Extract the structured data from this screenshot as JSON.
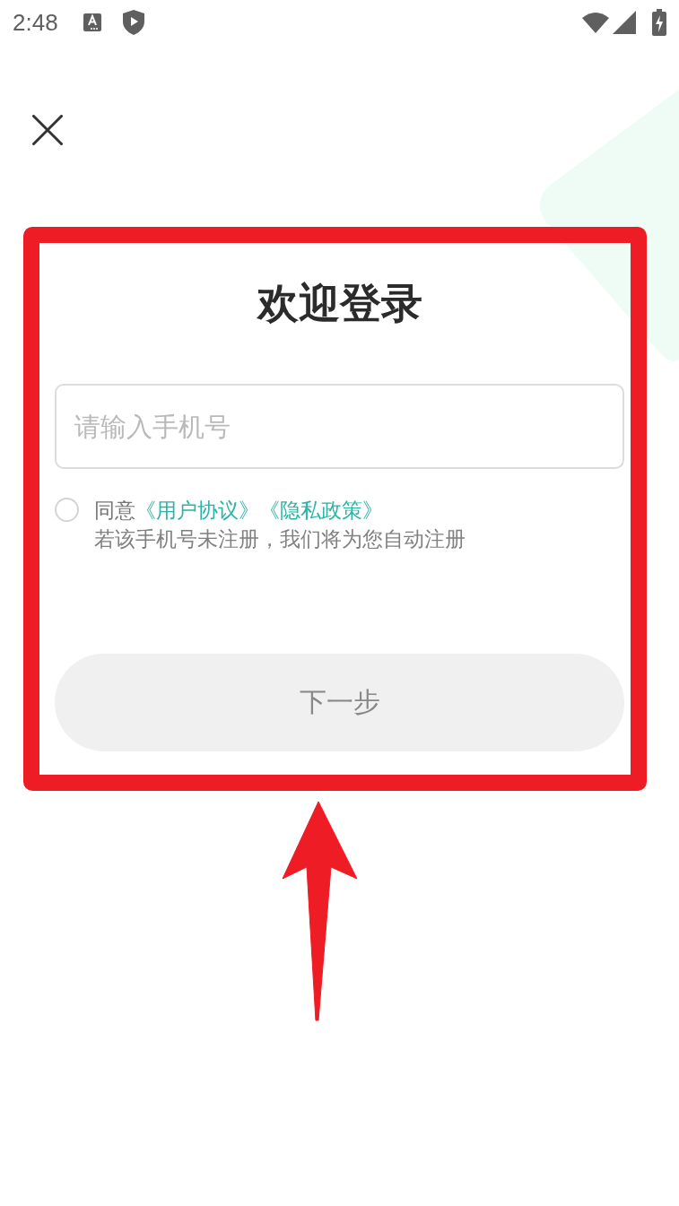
{
  "status_bar": {
    "time": "2:48"
  },
  "title": "欢迎登录",
  "phone_field": {
    "placeholder": "请输入手机号"
  },
  "agreement": {
    "checked": false,
    "prefix": "同意",
    "links": [
      "《用户协议》",
      "《隐私政策》"
    ],
    "note": "若该手机号未注册，我们将为您自动注册"
  },
  "next_button": {
    "label": "下一步",
    "disabled": true
  }
}
